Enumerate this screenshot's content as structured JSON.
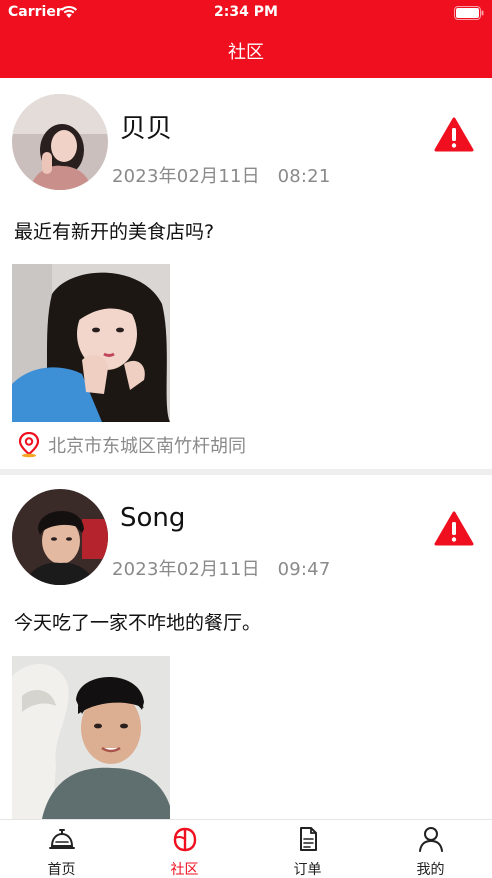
{
  "status_bar": {
    "carrier": "Carrier",
    "time": "2:34 PM"
  },
  "header": {
    "title": "社区"
  },
  "colors": {
    "brand": "#EF0F1E",
    "muted_text": "#8a8a8a",
    "divider": "#EEEEEE"
  },
  "posts": [
    {
      "author": "贝贝",
      "date": "2023年02月11日",
      "time": "08:21",
      "content": "最近有新开的美食店吗?",
      "location": "北京市东城区南竹杆胡同"
    },
    {
      "author": "Song",
      "date": "2023年02月11日",
      "time": "09:47",
      "content": "今天吃了一家不咋地的餐厅。"
    }
  ],
  "tabs": [
    {
      "label": "首页",
      "icon": "home-bell-icon"
    },
    {
      "label": "社区",
      "icon": "community-icon",
      "active": true
    },
    {
      "label": "订单",
      "icon": "order-document-icon"
    },
    {
      "label": "我的",
      "icon": "profile-icon"
    }
  ]
}
